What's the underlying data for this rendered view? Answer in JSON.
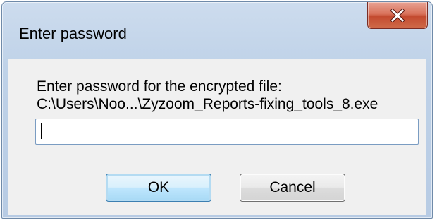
{
  "window": {
    "title": "Enter password"
  },
  "dialog": {
    "prompt_line1": "Enter password for the encrypted file:",
    "prompt_line2": "C:\\Users\\Noo...\\Zyzoom_Reports-fixing_tools_8.exe",
    "password_value": ""
  },
  "buttons": {
    "ok_label": "OK",
    "cancel_label": "Cancel"
  },
  "icons": {
    "close": "close-icon"
  },
  "colors": {
    "title_bar": "#bfd2e8",
    "close_button": "#c34a2f",
    "client_background": "#f0f0f0",
    "default_button_border": "#3c7fb1"
  }
}
